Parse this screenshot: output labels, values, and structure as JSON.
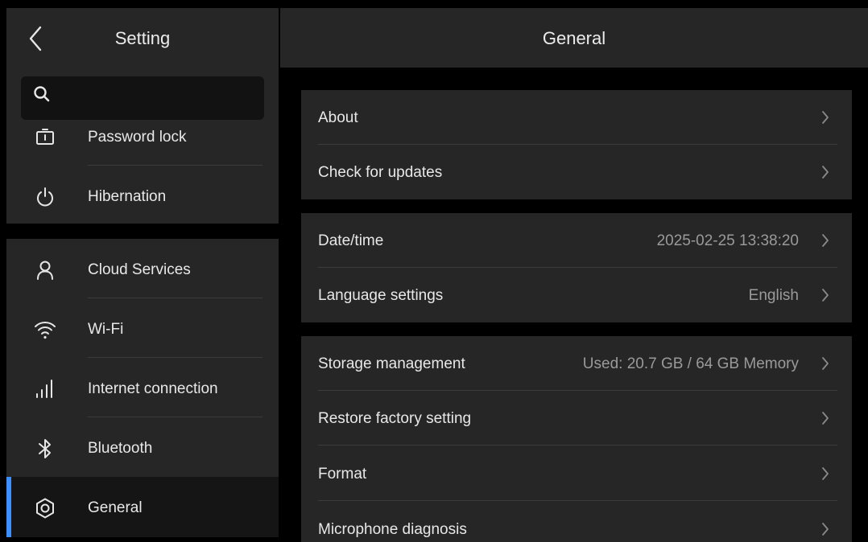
{
  "sidebar": {
    "title": "Setting",
    "search": {
      "placeholder": ""
    },
    "items_top": [
      {
        "label": "Password lock",
        "icon": "password-lock-icon"
      },
      {
        "label": "Hibernation",
        "icon": "power-icon"
      }
    ],
    "items_bottom": [
      {
        "label": "Cloud Services",
        "icon": "user-icon"
      },
      {
        "label": "Wi-Fi",
        "icon": "wifi-icon"
      },
      {
        "label": "Internet connection",
        "icon": "signal-bars-icon"
      },
      {
        "label": "Bluetooth",
        "icon": "bluetooth-icon"
      },
      {
        "label": "General",
        "icon": "gear-icon",
        "active": true
      }
    ]
  },
  "main": {
    "title": "General",
    "groups": [
      [
        {
          "label": "About",
          "value": ""
        },
        {
          "label": "Check for updates",
          "value": ""
        }
      ],
      [
        {
          "label": "Date/time",
          "value": "2025-02-25 13:38:20"
        },
        {
          "label": "Language settings",
          "value": "English"
        }
      ],
      [
        {
          "label": "Storage management",
          "value": "Used: 20.7 GB / 64 GB Memory"
        },
        {
          "label": "Restore factory setting",
          "value": ""
        },
        {
          "label": "Format",
          "value": ""
        },
        {
          "label": "Microphone diagnosis",
          "value": ""
        }
      ]
    ]
  },
  "colors": {
    "background": "#000000",
    "panel": "#262626",
    "accent": "#3d8eff",
    "text": "#e8e8e8",
    "secondary_text": "#9a9a9a"
  }
}
